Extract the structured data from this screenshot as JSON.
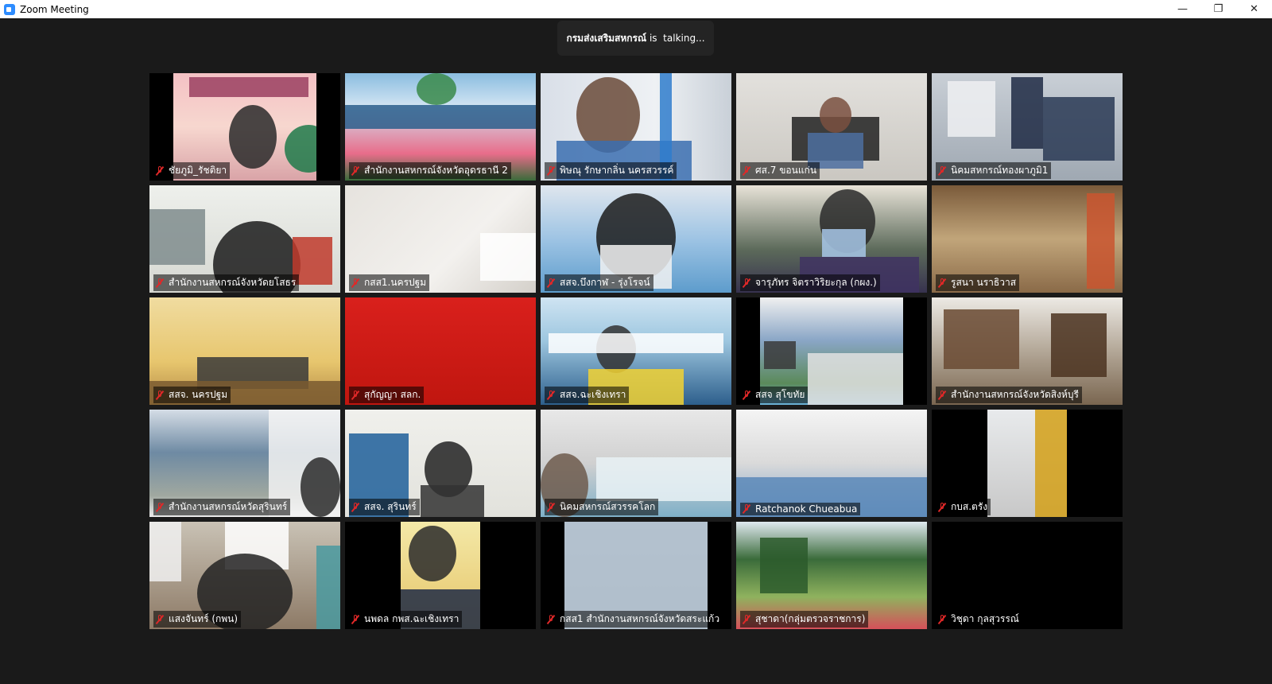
{
  "window": {
    "title": "Zoom Meeting",
    "minimize_glyph": "—",
    "restore_glyph": "❐",
    "close_glyph": "✕"
  },
  "talking": {
    "speaker": "กรมส่งเสริมสหกรณ์",
    "suffix": " is  talking..."
  },
  "participants": [
    {
      "name": "ชัยภูมิ_รัชติยา",
      "muted": true,
      "video": true
    },
    {
      "name": "สำนักงานสหกรณ์จังหวัดอุดรธานี 2",
      "muted": true,
      "video": true
    },
    {
      "name": "พิษณุ รักษากลิ่น นครสวรรค์",
      "muted": true,
      "video": true
    },
    {
      "name": "ศส.7 ขอนแก่น",
      "muted": true,
      "video": true
    },
    {
      "name": "นิคมสหกรณ์ทองผาภูมิ1",
      "muted": true,
      "video": true
    },
    {
      "name": "สำนักงานสหกรณ์จังหวัดยโสธร",
      "muted": true,
      "video": true
    },
    {
      "name": "กสส1.นครปฐม",
      "muted": true,
      "video": true
    },
    {
      "name": "สสจ.บึงกาฬ - รุ่งโรจน์",
      "muted": true,
      "video": true
    },
    {
      "name": "จารุภัทร จิตราวิริยะกุล (กผง.)",
      "muted": true,
      "video": true
    },
    {
      "name": "รูสนา นราธิวาส",
      "muted": true,
      "video": true
    },
    {
      "name": "สสจ. นครปฐม",
      "muted": true,
      "video": true
    },
    {
      "name": "สุกัญญา สลก.",
      "muted": true,
      "video": true
    },
    {
      "name": "สสจ.ฉะเชิงเทรา",
      "muted": true,
      "video": true
    },
    {
      "name": "สสจ สุโขทัย",
      "muted": true,
      "video": true
    },
    {
      "name": "สำนักงานสหกรณ์จังหวัดสิงห์บุรี",
      "muted": true,
      "video": true
    },
    {
      "name": "สำนักงานสหกรณ์หวัดสุรินทร์",
      "muted": true,
      "video": true
    },
    {
      "name": "สสจ. สุรินทร์",
      "muted": true,
      "video": true
    },
    {
      "name": "นิคมสหกรณ์สวรรคโลก",
      "muted": true,
      "video": true
    },
    {
      "name": "Ratchanok Chueabua",
      "muted": true,
      "video": true
    },
    {
      "name": "กบส.ตรัง",
      "muted": true,
      "video": true
    },
    {
      "name": "แสงจันทร์ (กพน)",
      "muted": true,
      "video": true
    },
    {
      "name": "นพดล  กพส.ฉะเชิงเทรา",
      "muted": true,
      "video": true
    },
    {
      "name": "กสส1 สำนักงานสหกรณ์จังหวัดสระแก้ว",
      "muted": true,
      "video": true
    },
    {
      "name": "สุชาดา(กลุ่มตรวจราชการ)",
      "muted": true,
      "video": true
    },
    {
      "name": "วิชุดา กุลสุวรรณ์",
      "muted": true,
      "video": false
    }
  ]
}
